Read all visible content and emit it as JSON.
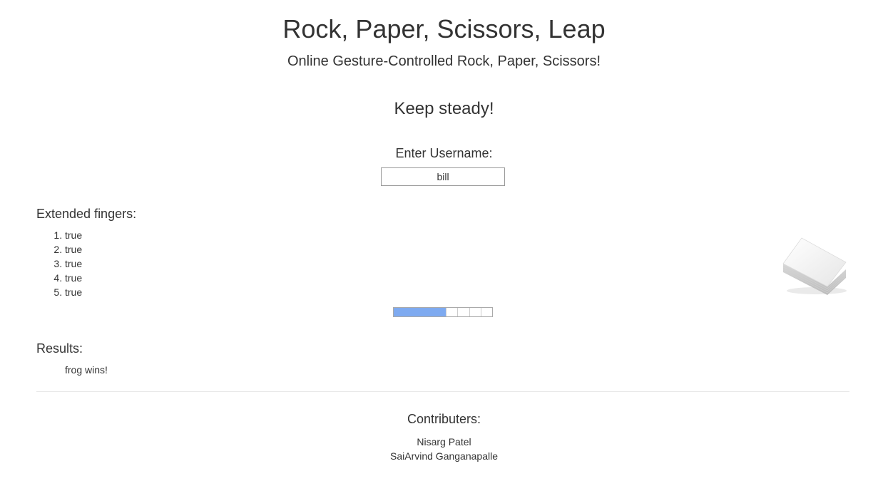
{
  "header": {
    "title": "Rock, Paper, Scissors, Leap",
    "subtitle": "Online Gesture-Controlled Rock, Paper, Scissors!"
  },
  "game": {
    "status": "Keep steady!",
    "username_label": "Enter Username:",
    "username_value": "bill",
    "detected_gesture_icon": "paper-stack-image",
    "progress_fraction": 0.53
  },
  "fingers": {
    "heading": "Extended fingers:",
    "items": [
      "true",
      "true",
      "true",
      "true",
      "true"
    ]
  },
  "results": {
    "heading": "Results:",
    "text": "frog wins!"
  },
  "contributors": {
    "heading": "Contributers:",
    "names": [
      "Nisarg Patel",
      "SaiArvind Ganganapalle"
    ]
  },
  "colors": {
    "progress_fill": "#7eaaf0",
    "text": "#333333",
    "divider": "#e8e8e8"
  }
}
